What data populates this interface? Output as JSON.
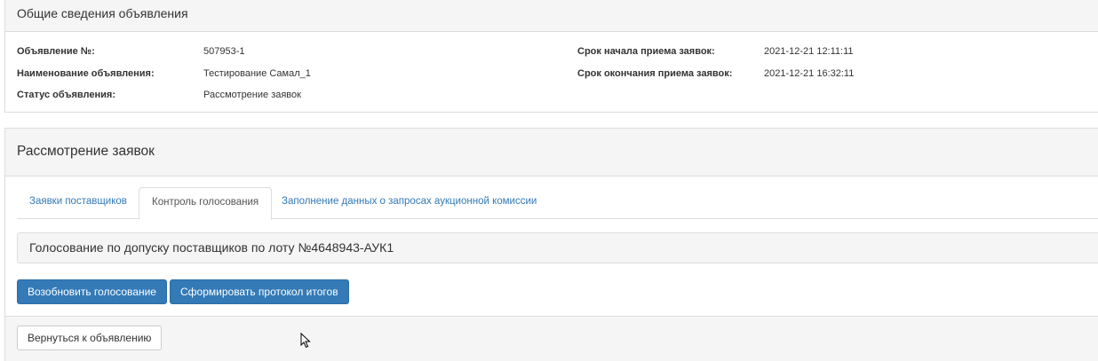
{
  "general": {
    "title": "Общие сведения объявления",
    "left": [
      {
        "label": "Объявление №:",
        "value": "507953-1"
      },
      {
        "label": "Наименование объявления:",
        "value": "Тестирование Самал_1"
      },
      {
        "label": "Статус объявления:",
        "value": "Рассмотрение заявок"
      }
    ],
    "right": [
      {
        "label": "Срок начала приема заявок:",
        "value": "2021-12-21 12:11:11"
      },
      {
        "label": "Срок окончания приема заявок:",
        "value": "2021-12-21 16:32:11"
      }
    ]
  },
  "review": {
    "title": "Рассмотрение заявок",
    "tabs": [
      {
        "label": "Заявки поставщиков",
        "active": false
      },
      {
        "label": "Контроль голосования",
        "active": true
      },
      {
        "label": "Заполнение данных о запросах аукционной комиссии",
        "active": false
      }
    ],
    "voting_title": "Голосование по допуску поставщиков по лоту №4648943-АУК1",
    "resume_button": "Возобновить голосование",
    "protocol_button": "Сформировать протокол итогов",
    "back_button": "Вернуться к объявлению"
  },
  "colors": {
    "primary": "#337ab7",
    "panel_bg": "#f5f5f5",
    "border": "#dddddd"
  }
}
